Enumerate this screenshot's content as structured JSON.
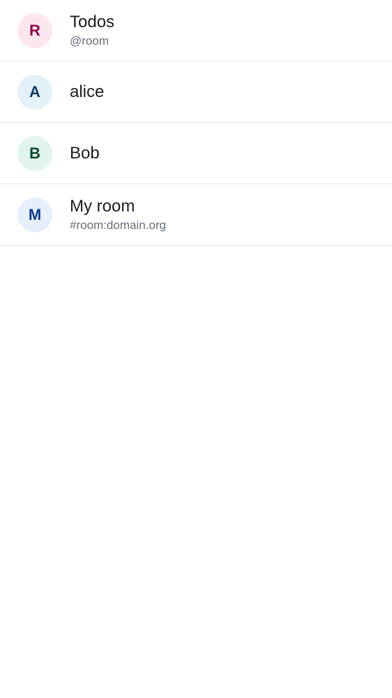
{
  "list": {
    "items": [
      {
        "initial": "R",
        "title": "Todos",
        "subtitle": "@room",
        "avatar_bg": "#fde7ee",
        "avatar_fg": "#8c0a4a"
      },
      {
        "initial": "A",
        "title": "alice",
        "subtitle": "",
        "avatar_bg": "#e3f2f8",
        "avatar_fg": "#0b3a66"
      },
      {
        "initial": "B",
        "title": "Bob",
        "subtitle": "",
        "avatar_bg": "#e1f5ec",
        "avatar_fg": "#0d4a2c"
      },
      {
        "initial": "M",
        "title": "My room",
        "subtitle": "#room:domain.org",
        "avatar_bg": "#e6f0fd",
        "avatar_fg": "#0b3a8c"
      }
    ]
  }
}
